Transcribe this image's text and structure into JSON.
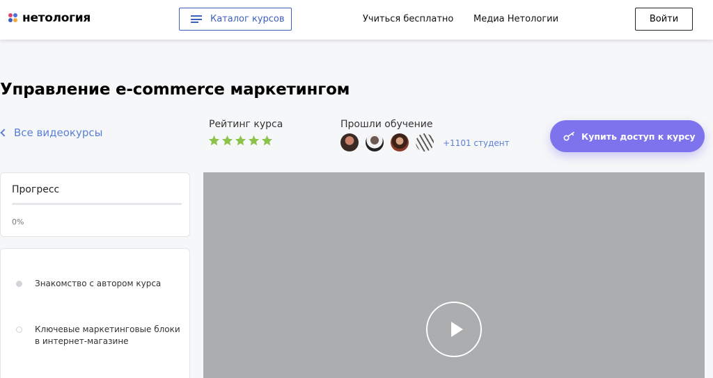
{
  "header": {
    "logo_text": "нетология",
    "catalog_label": "Каталог курсов",
    "nav": [
      "Учиться бесплатно",
      "Медиа Нетологии"
    ],
    "login_label": "Войти"
  },
  "course": {
    "title": "Управление e-commerce маркетингом",
    "back_label": "Все видеокурсы",
    "rating_label": "Рейтинг курса",
    "rating_value": 5,
    "passed_label": "Прошли обучение",
    "students_count": "+1101 студент",
    "buy_label": "Купить доступ к курсу"
  },
  "progress": {
    "title": "Прогресс",
    "value_label": "0%",
    "fraction": 0
  },
  "lessons": [
    {
      "label": "Знакомство с автором курса",
      "state": "current"
    },
    {
      "label": "Ключевые маркетинговые блоки в интернет-магазине",
      "state": "pending"
    }
  ],
  "icons": {
    "logo": "logo-dots-icon",
    "catalog": "menu-icon",
    "back": "chevron-left-icon",
    "rating": "star-icon",
    "buy": "key-icon",
    "video": "play-icon"
  },
  "colors": {
    "accent_blue": "#3d5fbd",
    "link_blue": "#5b7fd8",
    "buy_button": "#7c73ed",
    "star_green": "#8bc34a",
    "video_bg": "#acadaf"
  }
}
